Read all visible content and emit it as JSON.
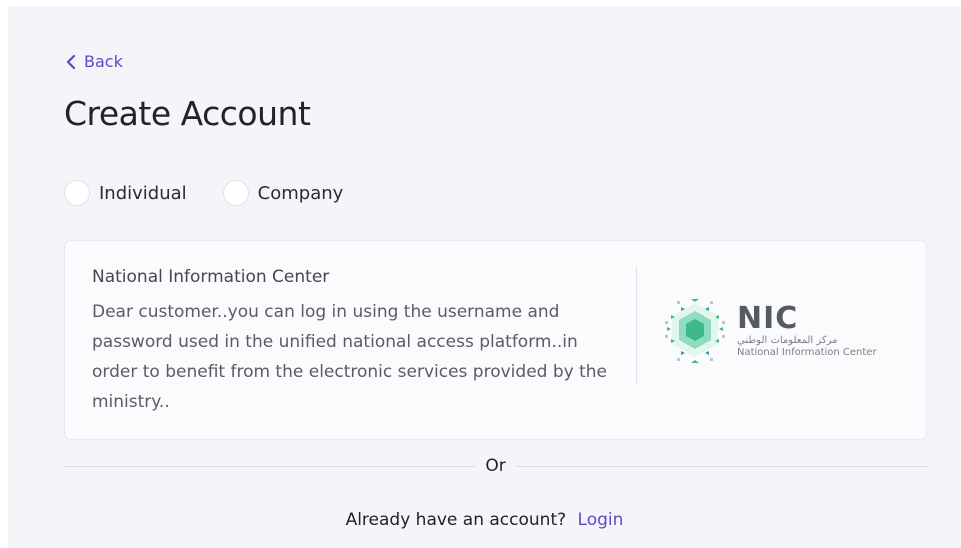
{
  "nav": {
    "back_label": "Back"
  },
  "page": {
    "title": "Create Account"
  },
  "account_type": {
    "options": [
      {
        "label": "Individual"
      },
      {
        "label": "Company"
      }
    ]
  },
  "nic_card": {
    "title": "National Information Center",
    "message": "Dear customer..you can log in using the username and password used in the unified national access platform..in order to benefit from the electronic services provided by the ministry..",
    "logo": {
      "word": "NIC",
      "arabic": "مركز المعلومات الوطني",
      "english": "National Information Center"
    }
  },
  "divider": {
    "or_label": "Or"
  },
  "footer": {
    "prompt": "Already have an account?",
    "login_label": "Login"
  },
  "colors": {
    "accent": "#6247c9",
    "background": "#f4f5f8",
    "logo_green": "#3fb98a",
    "logo_teal": "#2e9bb0"
  }
}
